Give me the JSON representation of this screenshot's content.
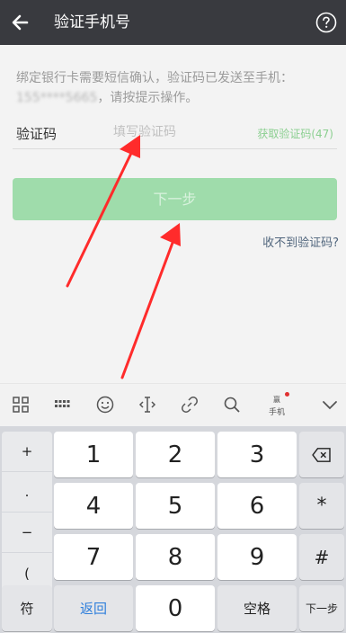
{
  "header": {
    "title": "验证手机号"
  },
  "notice": {
    "text_before": "绑定银行卡需要短信确认，验证码已发送至手机：",
    "phone": "155****5665",
    "text_after": "，请按提示操作。"
  },
  "code_field": {
    "label": "验证码",
    "placeholder": "填写验证码",
    "get_code": "获取验证码(47)"
  },
  "next_button": {
    "label": "下一步"
  },
  "no_code_link": {
    "label": "收不到验证码?"
  },
  "keyboard_toolbar": {
    "items": [
      "grid-icon",
      "keyboard-icon",
      "emoji-icon",
      "cursor-icon",
      "link-icon",
      "search-icon",
      "phone-icon",
      "collapse-icon"
    ],
    "phone_badge_text": "赢",
    "phone_label": "手机"
  },
  "keyboard": {
    "side_keys": [
      "+",
      ".",
      "−",
      "("
    ],
    "digits": [
      "1",
      "2",
      "3",
      "4",
      "5",
      "6",
      "7",
      "8",
      "9",
      "0"
    ],
    "right_keys": [
      "⌫",
      "*",
      "#"
    ],
    "bottom": {
      "fu": "符",
      "back": "返回",
      "space": "空格",
      "next": "下一步"
    }
  },
  "colors": {
    "topbar": "#393a3f",
    "button_disabled": "#9fdcab",
    "link": "#51667d",
    "get_code": "#8bcf90",
    "arrow": "#ff2b2b"
  }
}
